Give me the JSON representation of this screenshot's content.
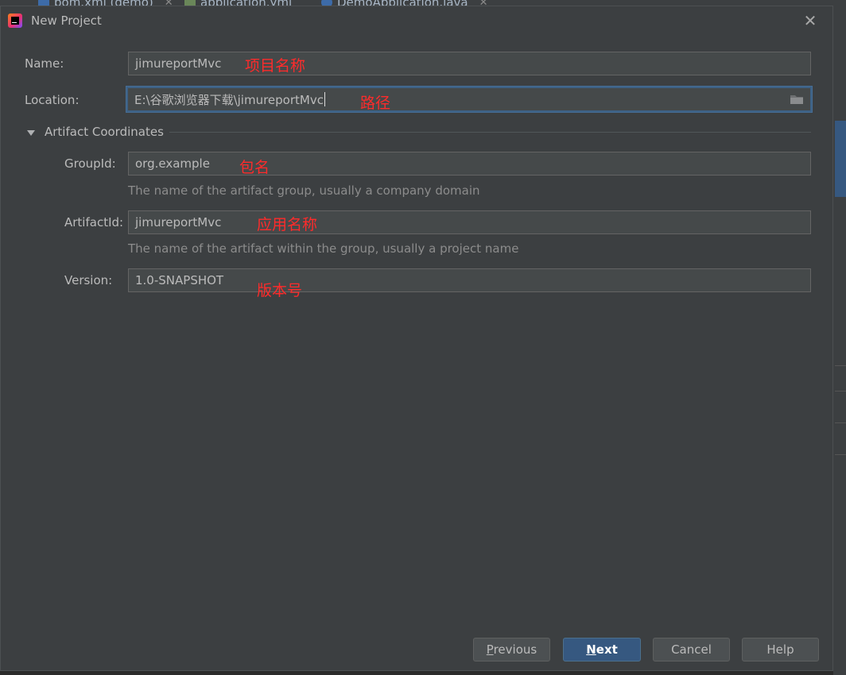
{
  "background_tabs": [
    {
      "label": "pom.xml (demo)"
    },
    {
      "label": "application.yml"
    },
    {
      "label": "DemoApplication.java"
    }
  ],
  "dialog": {
    "title": "New Project",
    "close_glyph": "✕"
  },
  "form": {
    "name": {
      "label": "Name:",
      "value": "jimureportMvc",
      "annotation": "项目名称"
    },
    "location": {
      "label": "Location:",
      "value": "E:\\谷歌浏览器下载\\jimureportMvc",
      "annotation": "路径"
    },
    "section": {
      "label": "Artifact Coordinates"
    },
    "group_id": {
      "label": "GroupId:",
      "value": "org.example",
      "annotation": "包名",
      "hint": "The name of the artifact group, usually a company domain"
    },
    "artifact_id": {
      "label": "ArtifactId:",
      "value": "jimureportMvc",
      "annotation": "应用名称",
      "hint": "The name of the artifact within the group, usually a project name"
    },
    "version": {
      "label": "Version:",
      "value": "1.0-SNAPSHOT",
      "annotation": "版本号"
    }
  },
  "buttons": {
    "previous": {
      "mnemonic": "P",
      "rest": "revious"
    },
    "next": {
      "mnemonic": "N",
      "rest": "ext"
    },
    "cancel": "Cancel",
    "help": "Help"
  },
  "colors": {
    "dialog_bg": "#3c3f41",
    "field_bg": "#45494a",
    "focus_border": "#3d6185",
    "primary_button": "#365880",
    "annotation_red": "#ff2b2b"
  },
  "icons": {
    "app": "intellij-idea-icon",
    "close": "close-icon",
    "folder": "folder-icon",
    "collapse": "triangle-down-icon"
  }
}
